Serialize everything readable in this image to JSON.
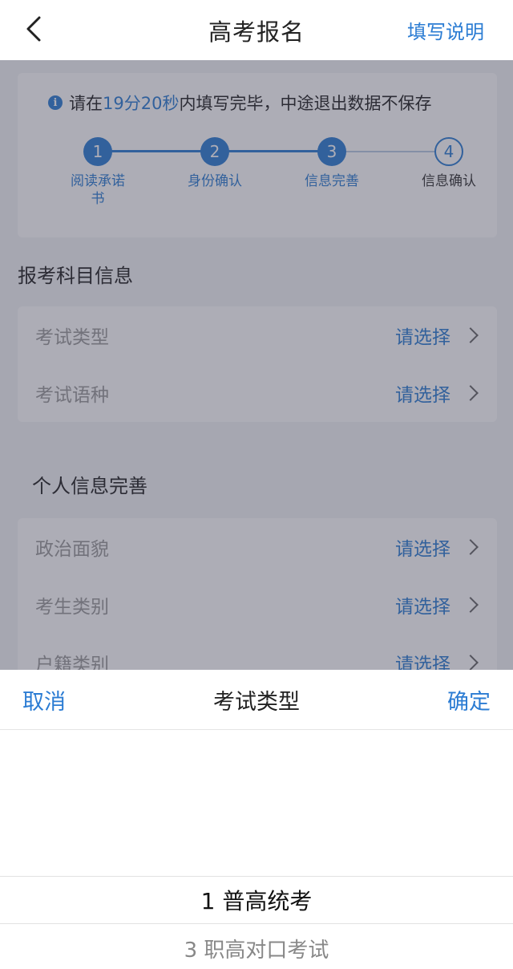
{
  "header": {
    "title": "高考报名",
    "help_label": "填写说明"
  },
  "timer": {
    "prefix": "请在",
    "time": "19分20秒",
    "suffix": "内填写完毕，中途退出数据不保存"
  },
  "steps": [
    {
      "number": "1",
      "label": "阅读承诺书",
      "state": "done"
    },
    {
      "number": "2",
      "label": "身份确认",
      "state": "done"
    },
    {
      "number": "3",
      "label": "信息完善",
      "state": "current"
    },
    {
      "number": "4",
      "label": "信息确认",
      "state": "pending"
    }
  ],
  "sections": {
    "exam_subject": {
      "title": "报考科目信息",
      "rows": [
        {
          "label": "考试类型",
          "value": "请选择"
        },
        {
          "label": "考试语种",
          "value": "请选择"
        }
      ]
    },
    "personal": {
      "title": "个人信息完善",
      "rows": [
        {
          "label": "政治面貌",
          "value": "请选择"
        },
        {
          "label": "考生类别",
          "value": "请选择"
        },
        {
          "label": "户籍类别",
          "value": "请选择"
        }
      ]
    }
  },
  "picker": {
    "title": "考试类型",
    "cancel_label": "取消",
    "confirm_label": "确定",
    "options": [
      {
        "label": "1 普高统考",
        "selected": true
      },
      {
        "label": "3 职高对口考试",
        "selected": false
      }
    ]
  },
  "colors": {
    "accent": "#2b7cd3",
    "text": "#222222",
    "muted": "#999999"
  }
}
